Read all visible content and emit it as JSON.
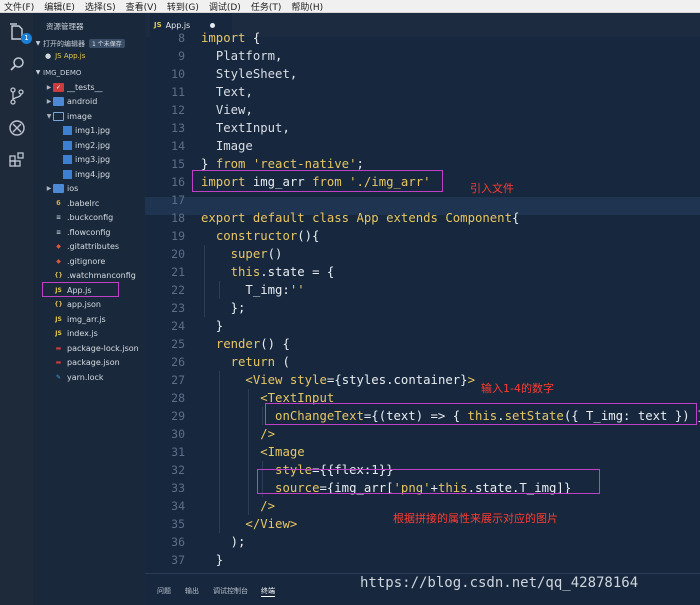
{
  "menu": [
    "文件(F)",
    "编辑(E)",
    "选择(S)",
    "查看(V)",
    "转到(G)",
    "调试(D)",
    "任务(T)",
    "帮助(H)"
  ],
  "activity": {
    "badge": "1"
  },
  "explorer": {
    "title": "资源管理器",
    "open_editors": "打开的编辑器",
    "unsaved": "1 个未保存",
    "open_file": "JS  App.js",
    "project": "IMG_DEMO",
    "items": [
      {
        "label": "__tests__"
      },
      {
        "label": "android"
      },
      {
        "label": "image"
      },
      {
        "label": "img1.jpg"
      },
      {
        "label": "img2.jpg"
      },
      {
        "label": "img3.jpg"
      },
      {
        "label": "img4.jpg"
      },
      {
        "label": "ios"
      },
      {
        "label": ".babelrc"
      },
      {
        "label": ".buckconfig"
      },
      {
        "label": ".flowconfig"
      },
      {
        "label": ".gitattributes"
      },
      {
        "label": ".gitignore"
      },
      {
        "label": ".watchmanconfig"
      },
      {
        "label": "App.js"
      },
      {
        "label": "app.json"
      },
      {
        "label": "img_arr.js"
      },
      {
        "label": "index.js"
      },
      {
        "label": "package-lock.json"
      },
      {
        "label": "package.json"
      },
      {
        "label": "yarn.lock"
      }
    ]
  },
  "editor": {
    "tab": "App.js",
    "line_numbers": [
      "8",
      "9",
      "10",
      "11",
      "12",
      "13",
      "14",
      "15",
      "16",
      "17",
      "18",
      "19",
      "20",
      "21",
      "22",
      "23",
      "24",
      "25",
      "26",
      "27",
      "28",
      "29",
      "30",
      "31",
      "32",
      "33",
      "34",
      "35",
      "36",
      "37"
    ],
    "notes": {
      "import": "引入文件",
      "input": "输入1-4的数字",
      "source": "根据拼接的属性来展示对应的图片"
    }
  },
  "panel": {
    "tabs": [
      "问题",
      "输出",
      "调试控制台",
      "终端"
    ]
  },
  "watermark": "https://blog.csdn.net/qq_42878164",
  "colors": {
    "annotation": "#c040c8",
    "note": "#ff3b30",
    "editor_bg": "#17273d"
  }
}
